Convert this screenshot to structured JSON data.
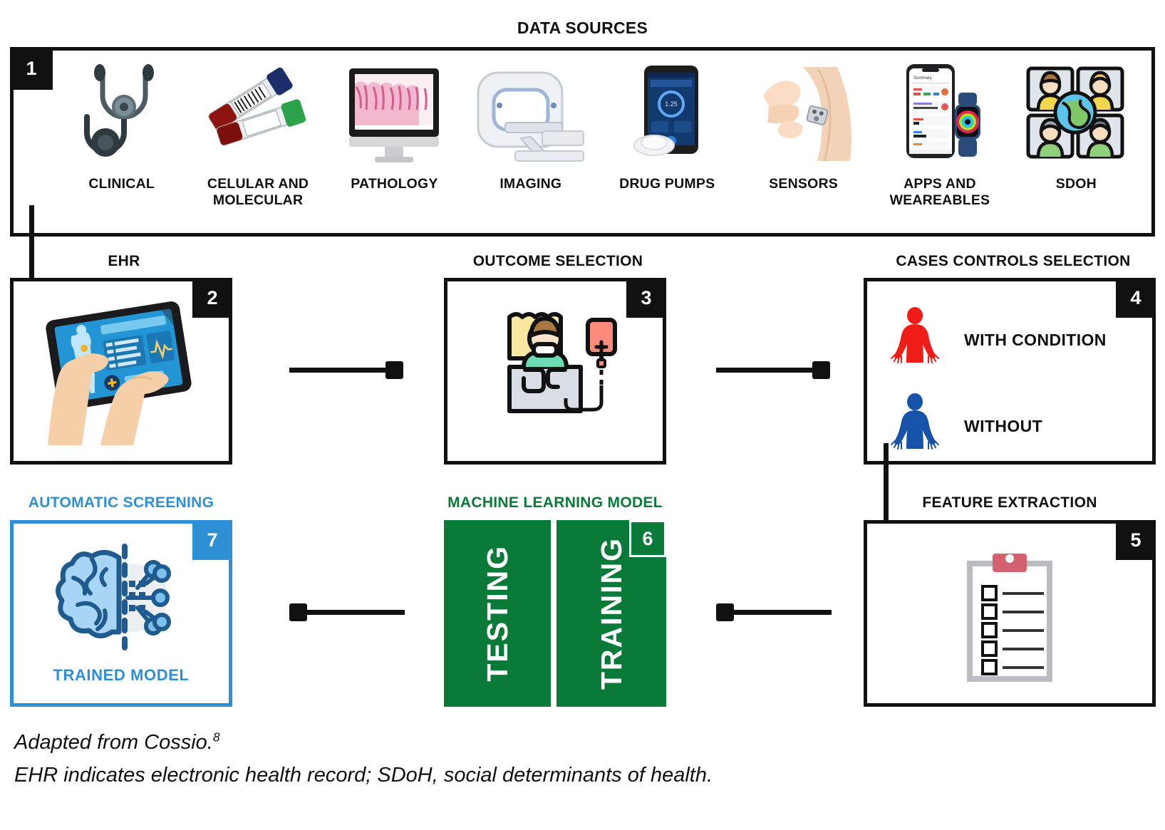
{
  "title": "DATA SOURCES",
  "data_sources": {
    "number": "1",
    "items": [
      {
        "label": "CLINICAL",
        "icon": "stethoscope-icon"
      },
      {
        "label": "CELULAR AND\nMOLECULAR",
        "icon": "blood-tubes-icon"
      },
      {
        "label": "PATHOLOGY",
        "icon": "monitor-histology-icon"
      },
      {
        "label": "IMAGING",
        "icon": "ct-scanner-icon"
      },
      {
        "label": "DRUG PUMPS",
        "icon": "insulin-pump-phone-icon"
      },
      {
        "label": "SENSORS",
        "icon": "skin-sensor-icon"
      },
      {
        "label": "APPS AND\nWEAREABLES",
        "icon": "phone-smartwatch-icon"
      },
      {
        "label": "SDOH",
        "icon": "people-globe-icon"
      }
    ]
  },
  "boxes": {
    "ehr": {
      "header": "EHR",
      "number": "2",
      "icon": "tablet-hands-icon"
    },
    "outcome": {
      "header": "OUTCOME SELECTION",
      "number": "3",
      "icon": "patient-bed-iv-icon"
    },
    "cases": {
      "header": "CASES CONTROLS SELECTION",
      "number": "4",
      "rows": [
        {
          "label": "WITH CONDITION",
          "color": "#ef1c17",
          "icon": "person-red-icon"
        },
        {
          "label": "WITHOUT",
          "color": "#1753a8",
          "icon": "person-blue-icon"
        }
      ]
    },
    "feature": {
      "header": "FEATURE EXTRACTION",
      "number": "5",
      "icon": "clipboard-checklist-icon"
    },
    "ml": {
      "header": "MACHINE LEARNING MODEL",
      "number": "6",
      "cells": [
        "TESTING",
        "TRAINING"
      ]
    },
    "screening": {
      "header": "AUTOMATIC SCREENING",
      "number": "7",
      "icon": "ai-brain-circuit-icon",
      "footer": "TRAINED MODEL"
    }
  },
  "colors": {
    "black": "#111111",
    "blue": "#2f8fd4",
    "green": "#0a7a38",
    "red": "#ef1c17",
    "dark_blue": "#1753a8"
  },
  "caption": {
    "line1_text": "Adapted from Cossio.",
    "line1_sup": "8",
    "line2": "EHR indicates electronic health record; SDoH, social determinants of health."
  }
}
